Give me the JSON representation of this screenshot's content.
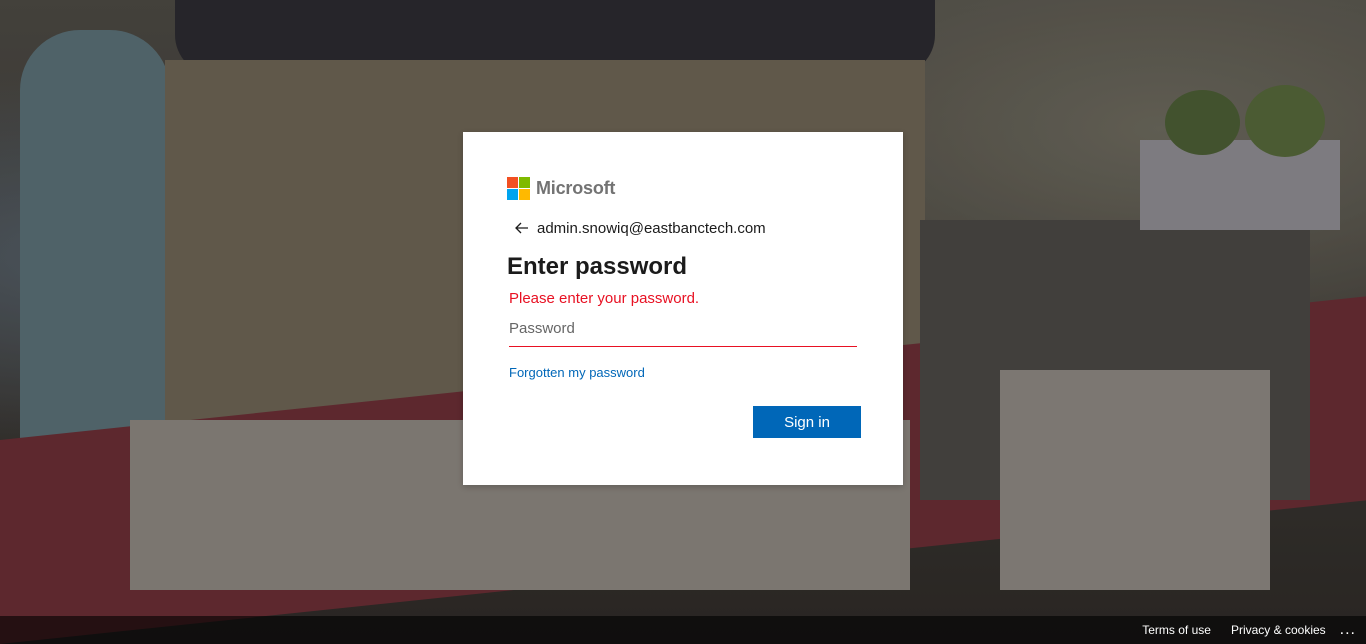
{
  "brand": {
    "name": "Microsoft",
    "logo_colors": [
      "#f25022",
      "#7fba00",
      "#00a4ef",
      "#ffb900"
    ]
  },
  "signin": {
    "account": "admin.snowiq@eastbanctech.com",
    "title": "Enter password",
    "error": "Please enter your password.",
    "password_placeholder": "Password",
    "forgot_link": "Forgotten my password",
    "submit_label": "Sign in",
    "back_icon": "arrow-left-icon"
  },
  "footer": {
    "terms": "Terms of use",
    "privacy": "Privacy & cookies",
    "more": "..."
  },
  "colors": {
    "accent": "#0067b8",
    "error": "#e81123"
  }
}
